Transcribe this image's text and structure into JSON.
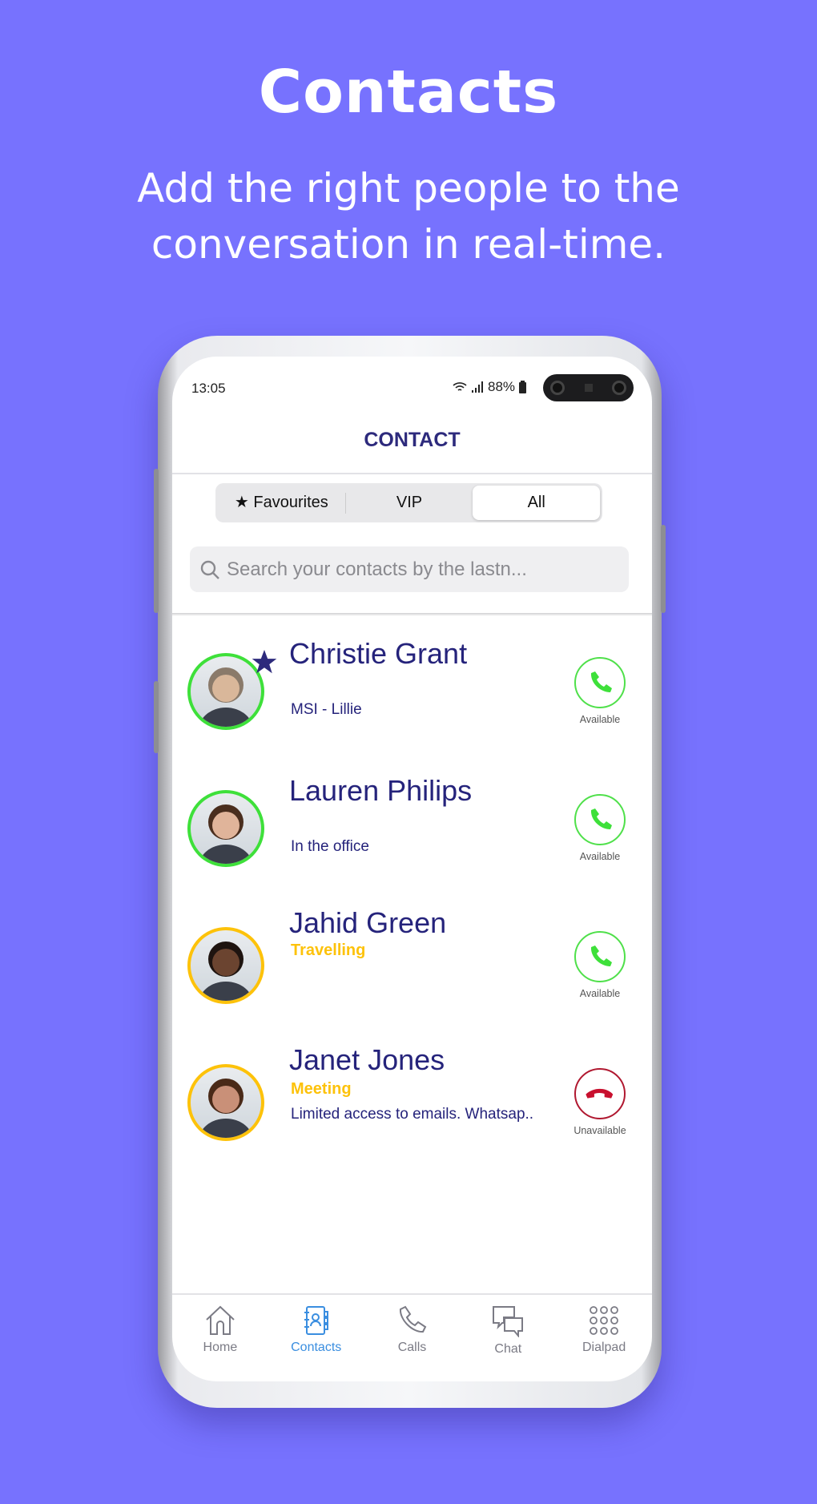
{
  "hero": {
    "title": "Contacts",
    "subtitle_line1": "Add the right people to the",
    "subtitle_line2": "conversation in real-time."
  },
  "status": {
    "time": "13:05",
    "battery": "88%"
  },
  "header": {
    "title": "CONTACT"
  },
  "tabs": [
    {
      "label": "Favourites",
      "icon": "star-icon"
    },
    {
      "label": "VIP"
    },
    {
      "label": "All",
      "selected": true
    }
  ],
  "search": {
    "placeholder": "Search your contacts by the lastn..."
  },
  "contacts": [
    {
      "name": "Christie Grant",
      "status": "",
      "note": "MSI - Lillie",
      "favourite": true,
      "ring": "#3ee03a",
      "call_label": "Available"
    },
    {
      "name": "Lauren Philips",
      "status": "",
      "note": "In the office",
      "favourite": false,
      "ring": "#3ee03a",
      "call_label": "Available"
    },
    {
      "name": "Jahid Green",
      "status": "Travelling",
      "note": "",
      "favourite": false,
      "ring": "#fdc20a",
      "call_label": "Available"
    },
    {
      "name": "Janet Jones",
      "status": "Meeting",
      "note": "Limited access to emails. Whatsap..",
      "favourite": false,
      "ring": "#fdc20a",
      "call_label": "Unavailable"
    }
  ],
  "nav": [
    {
      "label": "Home",
      "icon": "home-icon"
    },
    {
      "label": "Contacts",
      "icon": "address-book-icon",
      "active": true
    },
    {
      "label": "Calls",
      "icon": "phone-icon"
    },
    {
      "label": "Chat",
      "icon": "chat-icon"
    },
    {
      "label": "Dialpad",
      "icon": "dialpad-icon"
    }
  ],
  "colors": {
    "background": "#7772fe",
    "primary_text": "#25237b",
    "available": "#3ee03a",
    "unavailable": "#c8102e",
    "status_yellow": "#fdc20a",
    "nav_active": "#3a8ee0"
  }
}
